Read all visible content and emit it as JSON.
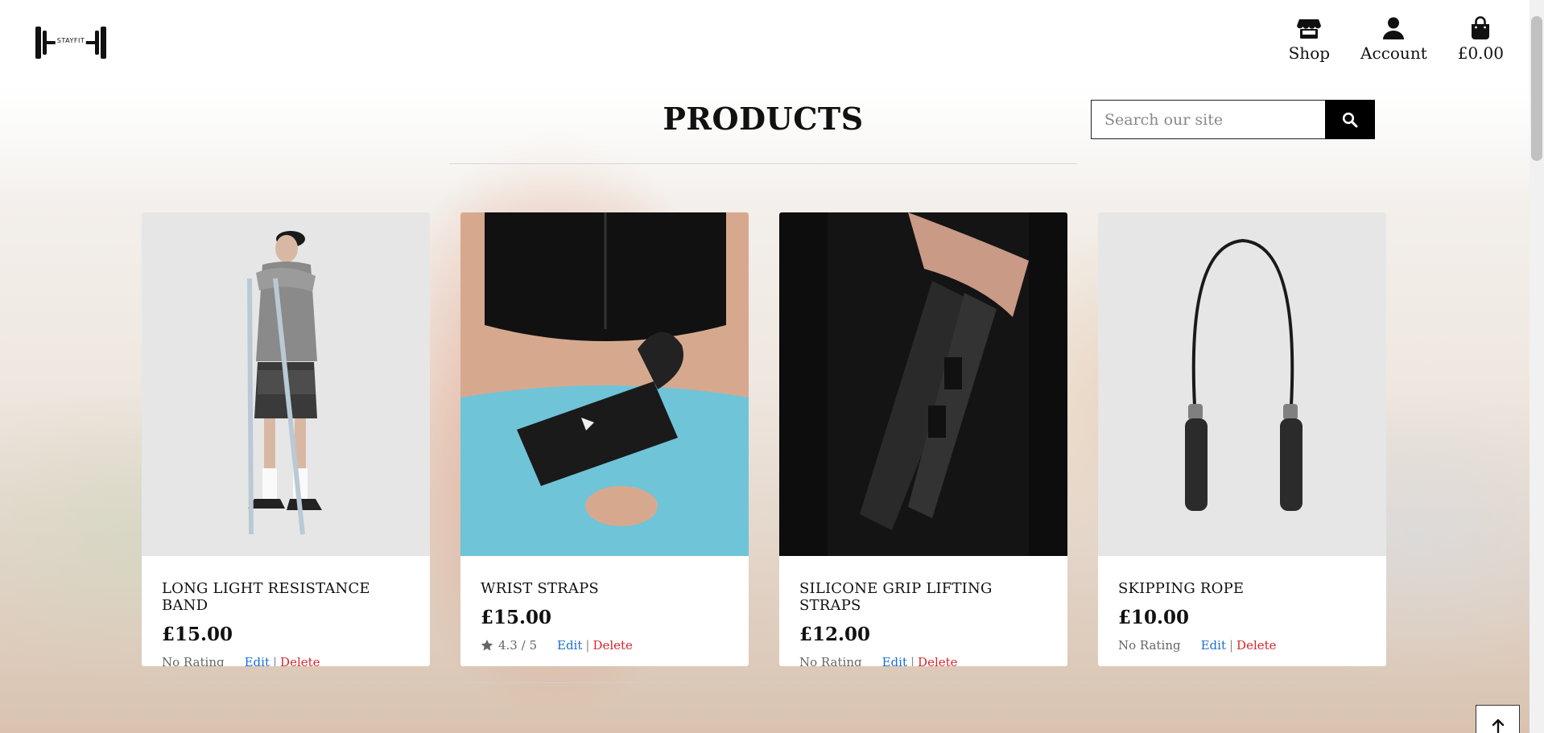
{
  "brand": {
    "logo_text": "STAYFIT"
  },
  "nav": {
    "shop": {
      "label": "Shop",
      "icon": "store-icon"
    },
    "account": {
      "label": "Account",
      "icon": "user-icon"
    },
    "bag": {
      "label": "£0.00",
      "icon": "shopping-bag-icon"
    }
  },
  "page": {
    "title": "PRODUCTS"
  },
  "search": {
    "placeholder": "Search our site",
    "value": ""
  },
  "products": [
    {
      "name": "LONG LIGHT RESISTANCE BAND",
      "price": "£15.00",
      "rating": "No Rating",
      "edit": "Edit",
      "sep": "|",
      "delete": "Delete"
    },
    {
      "name": "WRIST STRAPS",
      "price": "£15.00",
      "rating": "4.3 / 5",
      "edit": "Edit",
      "sep": "|",
      "delete": "Delete"
    },
    {
      "name": "SILICONE GRIP LIFTING STRAPS",
      "price": "£12.00",
      "rating": "No Rating",
      "edit": "Edit",
      "sep": "|",
      "delete": "Delete"
    },
    {
      "name": "SKIPPING ROPE",
      "price": "£10.00",
      "rating": "No Rating",
      "edit": "Edit",
      "sep": "|",
      "delete": "Delete"
    }
  ],
  "colors": {
    "edit_link": "#1a6fd1",
    "delete_link": "#d9262b",
    "accent": "#000000"
  }
}
